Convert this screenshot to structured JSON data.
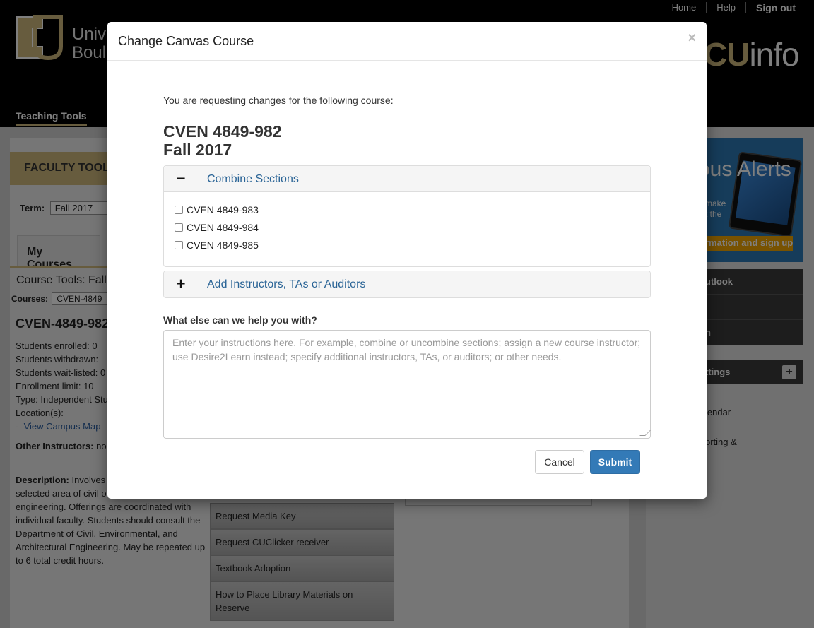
{
  "header": {
    "links": [
      "Home",
      "Help",
      "Sign out"
    ],
    "university_line1": "Univ",
    "university_line2": "Boul",
    "cuinfo_cu": "CU",
    "cuinfo_info": "info",
    "nav_tab": "Teaching Tools"
  },
  "page": {
    "faculty_tools": "FACULTY TOOL",
    "term_label": "Term:",
    "term_value": "Fall 2017",
    "tab_my_courses": "My Courses",
    "course_tools": "Course Tools: Fall",
    "courses_label": "Courses:",
    "courses_value": "CVEN-4849",
    "course_heading": "CVEN-4849-982",
    "details": [
      "Students enrolled: 0",
      "Students withdrawn:",
      "Students wait-listed: 0",
      "Enrollment limit: 10",
      "Type: Independent Stu",
      "Location(s):"
    ],
    "map_prefix": "-",
    "map_link": "View Campus Map",
    "other_instructors_label": "Other Instructors:",
    "other_instructors_value": "no",
    "description_label": "Description:",
    "description_text": " Involves depth study, research, selected area of civil or environmental engineering. Offerings are coordinated with individual faculty. Students should consult the Department of Civil, Environmental, and Architectural Engineering. May be repeated up to 6 total credit hours.",
    "tool_buttons": [
      "Request Media Key",
      "Request CUClicker receiver",
      "Textbook Adoption",
      "How to Place Library Materials on Reserve"
    ]
  },
  "right": {
    "alerts_title": "ous Alerts",
    "alerts_line1": "make",
    "alerts_line2": "t the",
    "alerts_button": "rmation and sign up",
    "menu_items": [
      "utlook",
      "",
      "n"
    ],
    "settings": "ttings",
    "settings_plus": "+",
    "calendar": "lendar",
    "reporting": "orting &"
  },
  "modal": {
    "title": "Change Canvas Course",
    "close": "×",
    "intro": "You are requesting changes for the following course:",
    "course_code": "CVEN 4849-982",
    "course_term": "Fall 2017",
    "combine": {
      "sign": "−",
      "title": "Combine Sections",
      "sections": [
        "CVEN 4849-983",
        "CVEN 4849-984",
        "CVEN 4849-985"
      ]
    },
    "add_instructors": {
      "sign": "+",
      "title": "Add Instructors, TAs or Auditors"
    },
    "help_label": "What else can we help you with?",
    "textarea_placeholder": "Enter your instructions here. For example, combine or uncombine sections; assign a new course instructor; use Desire2Learn instead; specify additional instructors, TAs, or auditors; or other needs.",
    "cancel": "Cancel",
    "submit": "Submit"
  },
  "colors": {
    "gold": "#cfb87c",
    "primary": "#337ab7",
    "link": "#2a6496"
  }
}
